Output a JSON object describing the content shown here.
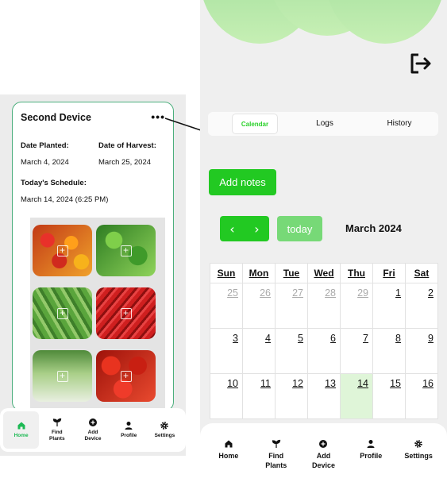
{
  "device_card": {
    "title": "Second Device",
    "more_label": "•••",
    "date_planted_label": "Date Planted:",
    "date_planted": "March 4, 2024",
    "date_harvest_label": "Date of Harvest:",
    "date_harvest": "March 25, 2024",
    "schedule_label": "Today's Schedule:",
    "schedule": "March 14, 2024 (6:25 PM)",
    "photos": [
      "bell-peppers",
      "leafy-greens",
      "green-beans",
      "red-chilies",
      "bok-choy",
      "tomatoes"
    ]
  },
  "left_nav": [
    {
      "label": "Home",
      "icon": "home-icon",
      "active": true
    },
    {
      "label": "Find\nPlants",
      "icon": "sprout-icon"
    },
    {
      "label": "Add\nDevice",
      "icon": "add-circle-icon"
    },
    {
      "label": "Profile",
      "icon": "person-icon"
    },
    {
      "label": "Settings",
      "icon": "gear-icon"
    }
  ],
  "tabs": {
    "calendar": "Calendar",
    "logs": "Logs",
    "history": "History",
    "active": "Calendar"
  },
  "calendar": {
    "add_notes": "Add notes",
    "prev": "‹",
    "next": "›",
    "today": "today",
    "title": "March 2024",
    "weekdays": [
      "Sun",
      "Mon",
      "Tue",
      "Wed",
      "Thu",
      "Fri",
      "Sat"
    ],
    "weeks": [
      [
        "25",
        "26",
        "27",
        "28",
        "29",
        "1",
        "2"
      ],
      [
        "3",
        "4",
        "5",
        "6",
        "7",
        "8",
        "9"
      ],
      [
        "10",
        "11",
        "12",
        "13",
        "14",
        "15",
        "16"
      ]
    ],
    "highlighted_day": "14"
  },
  "right_nav": [
    {
      "label": "Home",
      "icon": "home-icon"
    },
    {
      "label": "Find\nPlants",
      "icon": "sprout-icon"
    },
    {
      "label": "Add\nDevice",
      "icon": "add-circle-icon"
    },
    {
      "label": "Profile",
      "icon": "person-icon"
    },
    {
      "label": "Settings",
      "icon": "gear-icon"
    }
  ],
  "colors": {
    "accent": "#22c922",
    "today_bg": "#dff5d8",
    "card_border": "#4caf7d"
  }
}
